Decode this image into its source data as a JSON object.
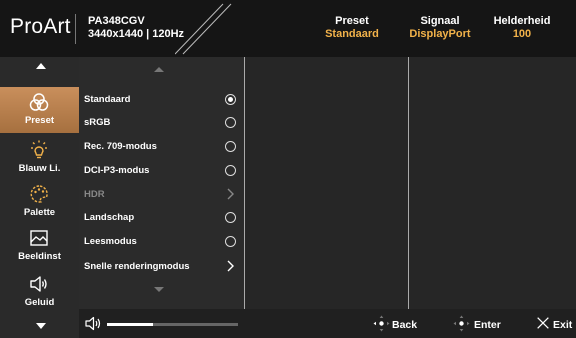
{
  "header": {
    "brand": "ProArt",
    "model": "PA348CGV",
    "resolution": "3440x1440 | 120Hz",
    "preset_label": "Preset",
    "preset_value": "Standaard",
    "signal_label": "Signaal",
    "signal_value": "DisplayPort",
    "brightness_label": "Helderheid",
    "brightness_value": "100"
  },
  "sidebar": {
    "items": [
      {
        "label": "Preset",
        "icon": "preset-icon",
        "active": true
      },
      {
        "label": "Blauw Li.",
        "icon": "blue-light-icon",
        "active": false
      },
      {
        "label": "Palette",
        "icon": "palette-icon",
        "active": false
      },
      {
        "label": "Beeldinst",
        "icon": "image-setup-icon",
        "active": false
      },
      {
        "label": "Geluid",
        "icon": "sound-icon",
        "active": false
      }
    ]
  },
  "preset_list": {
    "items": [
      {
        "label": "Standaard",
        "control": "radio",
        "selected": true,
        "enabled": true
      },
      {
        "label": "sRGB",
        "control": "radio",
        "selected": false,
        "enabled": true
      },
      {
        "label": "Rec. 709-modus",
        "control": "radio",
        "selected": false,
        "enabled": true
      },
      {
        "label": "DCI-P3-modus",
        "control": "radio",
        "selected": false,
        "enabled": true
      },
      {
        "label": "HDR",
        "control": "chevron",
        "selected": false,
        "enabled": false
      },
      {
        "label": "Landschap",
        "control": "radio",
        "selected": false,
        "enabled": true
      },
      {
        "label": "Leesmodus",
        "control": "radio",
        "selected": false,
        "enabled": true
      },
      {
        "label": "Snelle renderingmodus",
        "control": "chevron",
        "selected": false,
        "enabled": true
      }
    ]
  },
  "footer": {
    "volume_level": 0.35,
    "back_label": "Back",
    "enter_label": "Enter",
    "exit_label": "Exit"
  },
  "colors": {
    "accent_orange": "#f2b24a",
    "active_tab": "#b67e4b"
  }
}
